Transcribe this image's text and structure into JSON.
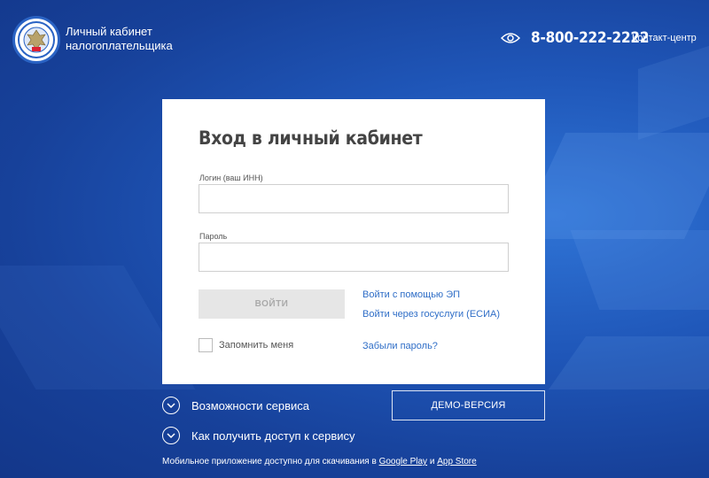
{
  "header": {
    "brand_line1": "Личный кабинет",
    "brand_line2": "налогоплательщика",
    "phone": "8-800-222-2222",
    "contact_label": "Контакт-центр"
  },
  "login_form": {
    "title": "Вход в личный кабинет",
    "login_label": "Логин (ваш ИНН)",
    "login_value": "",
    "password_label": "Пароль",
    "password_value": "",
    "submit_label": "ВОЙТИ",
    "link_ep": "Войти с помощью ЭП",
    "link_esia": "Войти через госуслуги (ЕСИА)",
    "remember_label": "Запомнить меня",
    "remember_checked": false,
    "forgot_label": "Забыли пароль?"
  },
  "below": {
    "features_label": "Возможности сервиса",
    "access_label": "Как получить доступ к сервису",
    "demo_label": "ДЕМО-ВЕРСИЯ"
  },
  "footer": {
    "text_prefix": "Мобильное приложение доступно для скачивания в",
    "google_play": "Google Play",
    "and": "и",
    "app_store": "App Store"
  },
  "icons": {
    "logo": "fns-emblem-icon",
    "accessibility": "eye-icon",
    "expand": "chevron-down-icon"
  },
  "colors": {
    "background": "#1d4fae",
    "link": "#2f6ec7",
    "button_disabled": "#e6e6e6"
  }
}
